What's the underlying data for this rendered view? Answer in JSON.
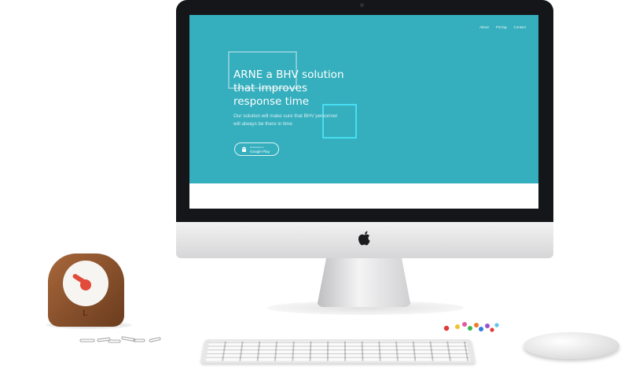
{
  "site": {
    "nav": {
      "items": [
        {
          "label": "About"
        },
        {
          "label": "Pricing"
        },
        {
          "label": "Contact"
        }
      ]
    },
    "hero": {
      "title": "ARNE a BHV solution\nthat improves\nresponse time",
      "subtitle": "Our solution will make sure that BHV personnel\nwill always be there in time",
      "store_button": {
        "small_label": "Download on",
        "big_label": "Google Play",
        "icon": "android-icon"
      }
    }
  },
  "colors": {
    "hero_background": "#35aebd",
    "accent_square": "#4ae0f6",
    "bezel": "#15161a",
    "clock_hand": "#e24a3a"
  },
  "clock": {
    "brand_mark": "L"
  }
}
